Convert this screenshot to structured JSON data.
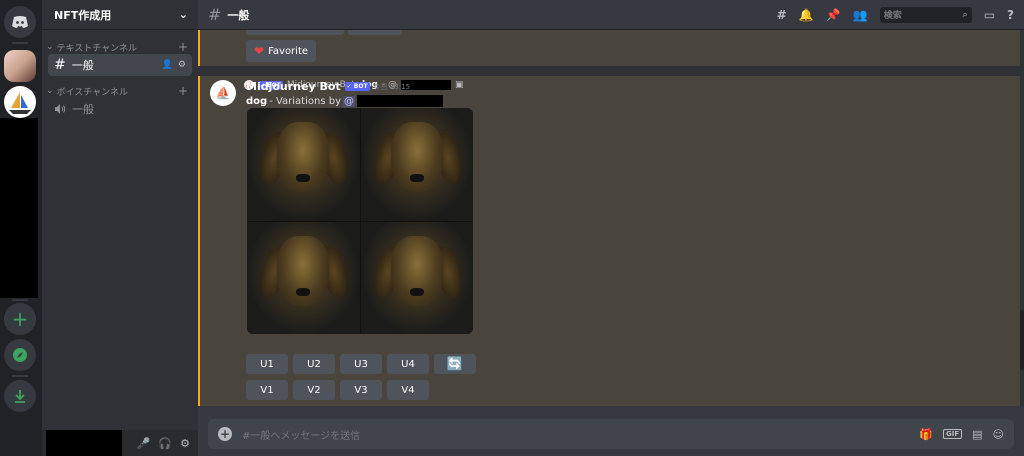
{
  "server_name": "NFT作成用",
  "categories": {
    "text": "テキストチャンネル",
    "voice": "ボイスチャンネル"
  },
  "channels": {
    "text": [
      {
        "name": "一般"
      }
    ],
    "voice": [
      {
        "name": "一般"
      }
    ]
  },
  "topbar": {
    "channel": "一般",
    "search_placeholder": "検索"
  },
  "message_prev": {
    "button_label": "Favorite"
  },
  "message": {
    "reply_author": "Midjourney Bot",
    "reply_prompt": "dog",
    "reply_sep": " - @",
    "author": "Midjourney Bot",
    "bot_tag": "BOT",
    "timestamp": "今日 13:15",
    "prompt": "dog",
    "text": " - Variations by ",
    "mention_prefix": "@",
    "buttons_row1": [
      "U1",
      "U2",
      "U3",
      "U4"
    ],
    "buttons_row2": [
      "V1",
      "V2",
      "V3",
      "V4"
    ]
  },
  "composer": {
    "placeholder": "#一般へメッセージを送信",
    "gif_label": "GIF"
  },
  "icons": {
    "home": "discord-logo-icon",
    "add_server": "plus-icon",
    "explore": "compass-icon",
    "download": "download-icon",
    "reroll": "refresh-icon"
  },
  "colors": {
    "accent_gold": "#faa81a",
    "blurple": "#5865f2",
    "green": "#3ba55d"
  }
}
